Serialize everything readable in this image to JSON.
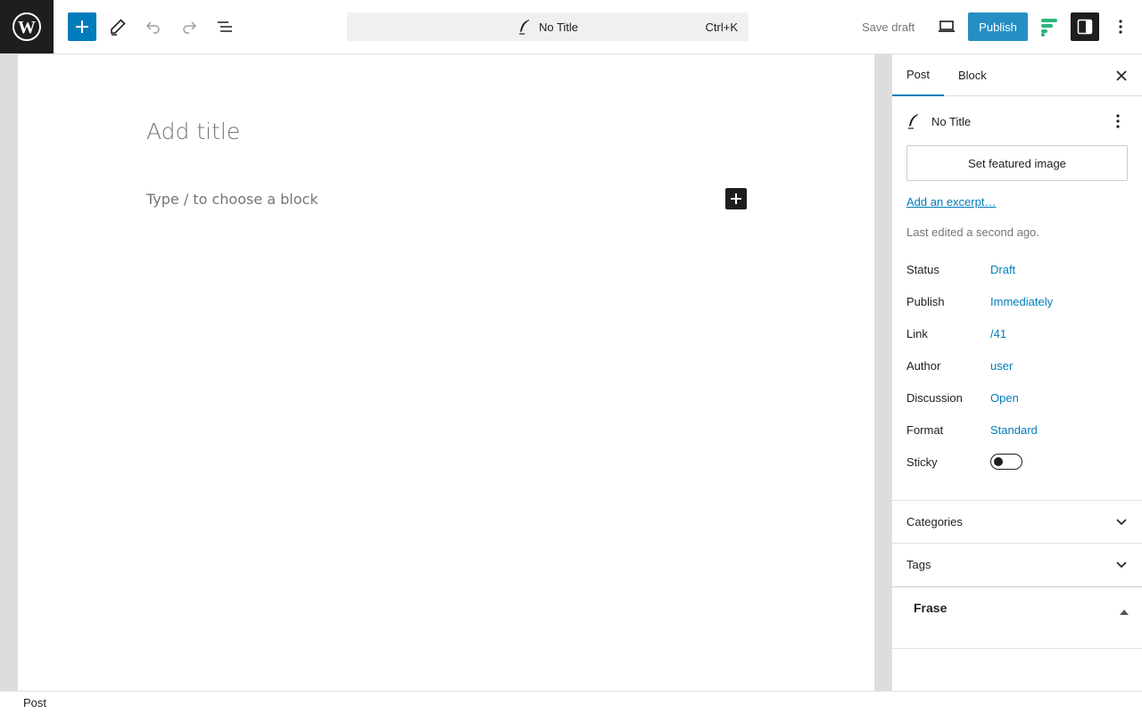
{
  "toolbar": {
    "logo_icon": "wordpress-logo-icon",
    "inserter_icon": "plus-icon",
    "tools_icon": "pencil-icon",
    "undo_icon": "undo-icon",
    "redo_icon": "redo-icon",
    "document_overview_icon": "list-view-icon",
    "command": {
      "title": "No Title",
      "shortcut": "Ctrl+K",
      "icon": "post-feather-icon"
    },
    "save_draft": "Save draft",
    "preview_icon": "desktop-icon",
    "publish": "Publish",
    "frase_icon": "frase-icon",
    "settings_icon": "sidebar-toggle-icon",
    "options_icon": "vertical-ellipsis-icon",
    "accent_color": "#007cba"
  },
  "editor": {
    "title_placeholder": "Add title",
    "block_placeholder": "Type / to choose a block",
    "block_inserter_icon": "plus-icon"
  },
  "sidebar": {
    "tabs": [
      {
        "label": "Post"
      },
      {
        "label": "Block"
      }
    ],
    "active_tab": "Post",
    "post_title": "No Title",
    "featured_image": "Set featured image",
    "excerpt_link": "Add an excerpt…",
    "last_edited": "Last edited a second ago.",
    "fields": [
      {
        "label": "Status",
        "value": "Draft"
      },
      {
        "label": "Publish",
        "value": "Immediately"
      },
      {
        "label": "Link",
        "value": "/41"
      },
      {
        "label": "Author",
        "value": "user"
      },
      {
        "label": "Discussion",
        "value": "Open"
      },
      {
        "label": "Format",
        "value": "Standard"
      }
    ],
    "sticky": {
      "label": "Sticky",
      "on": false
    },
    "panels": [
      {
        "label": "Categories"
      },
      {
        "label": "Tags"
      }
    ],
    "frase": {
      "title": "Frase"
    }
  },
  "footer": {
    "breadcrumb": "Post"
  }
}
